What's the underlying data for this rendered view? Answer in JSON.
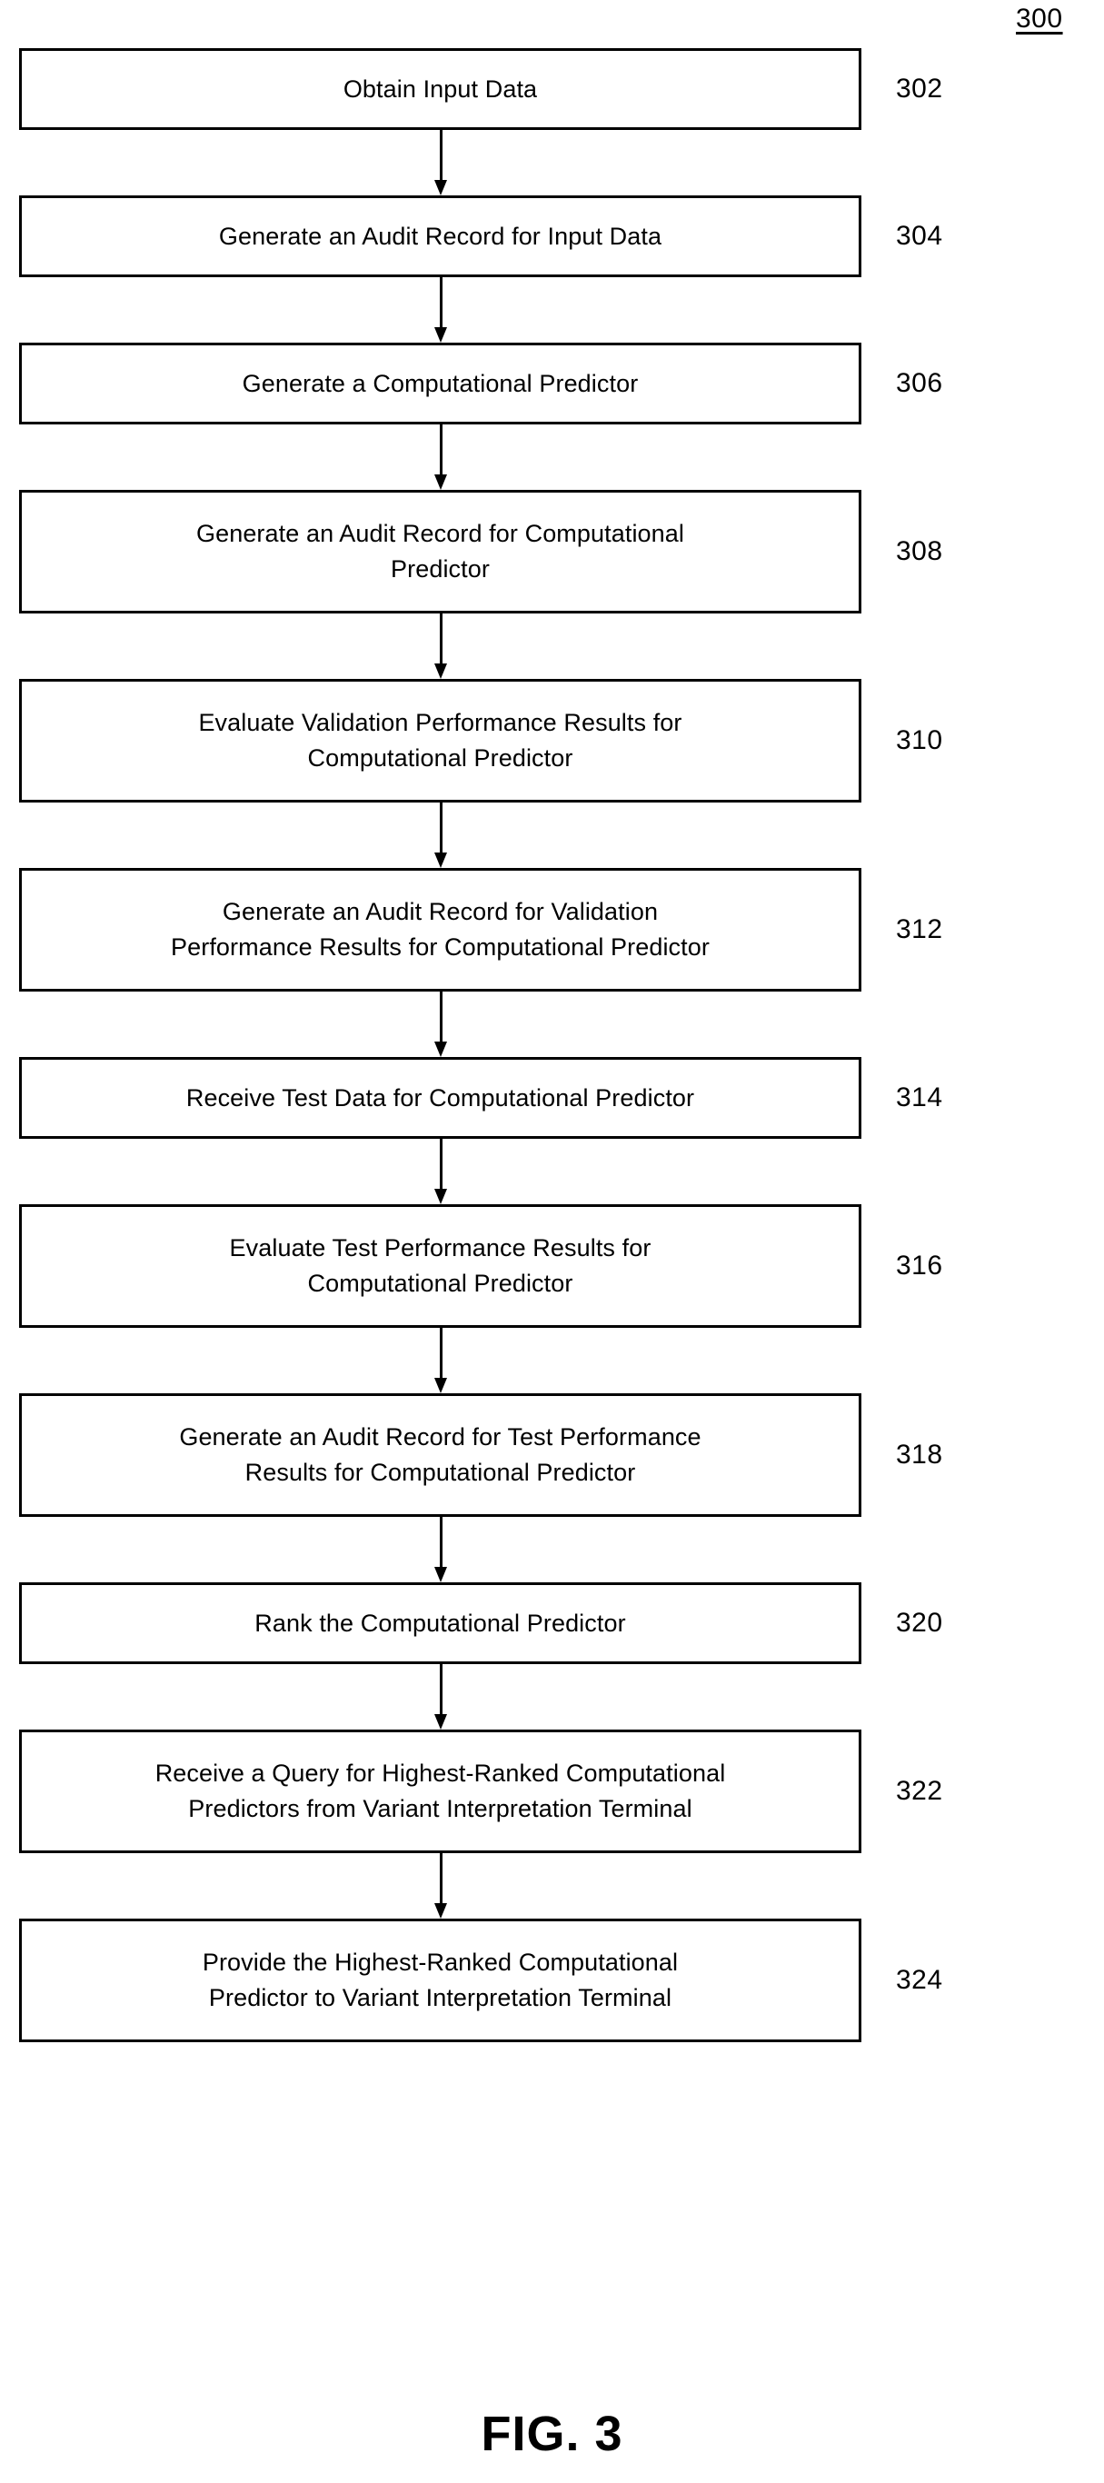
{
  "figure": {
    "reference_number": "300",
    "caption": "FIG. 3"
  },
  "flowchart": {
    "type": "flowchart",
    "orientation": "vertical",
    "steps": [
      {
        "number": "302",
        "text": "Obtain Input Data",
        "lines": 1
      },
      {
        "number": "304",
        "text": "Generate an Audit Record for Input Data",
        "lines": 1
      },
      {
        "number": "306",
        "text": "Generate a Computational Predictor",
        "lines": 1
      },
      {
        "number": "308",
        "text": "Generate an Audit Record for Computational\nPredictor",
        "lines": 2
      },
      {
        "number": "310",
        "text": "Evaluate Validation Performance Results for\nComputational Predictor",
        "lines": 2
      },
      {
        "number": "312",
        "text": "Generate an Audit Record for Validation\nPerformance Results for Computational Predictor",
        "lines": 2
      },
      {
        "number": "314",
        "text": "Receive Test Data for Computational Predictor",
        "lines": 1
      },
      {
        "number": "316",
        "text": "Evaluate Test Performance Results for\nComputational Predictor",
        "lines": 2
      },
      {
        "number": "318",
        "text": "Generate an Audit Record for Test Performance\nResults for Computational Predictor",
        "lines": 2
      },
      {
        "number": "320",
        "text": "Rank the Computational Predictor",
        "lines": 1
      },
      {
        "number": "322",
        "text": "Receive a Query for Highest-Ranked Computational\nPredictors from Variant Interpretation Terminal",
        "lines": 2
      },
      {
        "number": "324",
        "text": "Provide the Highest-Ranked Computational\nPredictor to Variant Interpretation Terminal",
        "lines": 2
      }
    ]
  }
}
